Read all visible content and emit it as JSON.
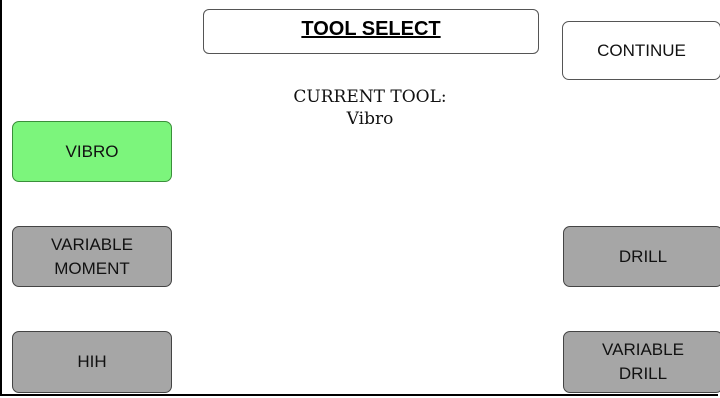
{
  "header": {
    "title": "TOOL SELECT"
  },
  "current_tool": {
    "label": "CURRENT TOOL:",
    "value": "Vibro"
  },
  "buttons": {
    "continue": "CONTINUE",
    "vibro": "VIBRO",
    "variable_moment": "VARIABLE\nMOMENT",
    "hih": "HIH",
    "drill": "DRILL",
    "variable_drill": "VARIABLE\nDRILL"
  },
  "colors": {
    "selected": "#7cf57c",
    "unselected": "#a6a6a6"
  }
}
